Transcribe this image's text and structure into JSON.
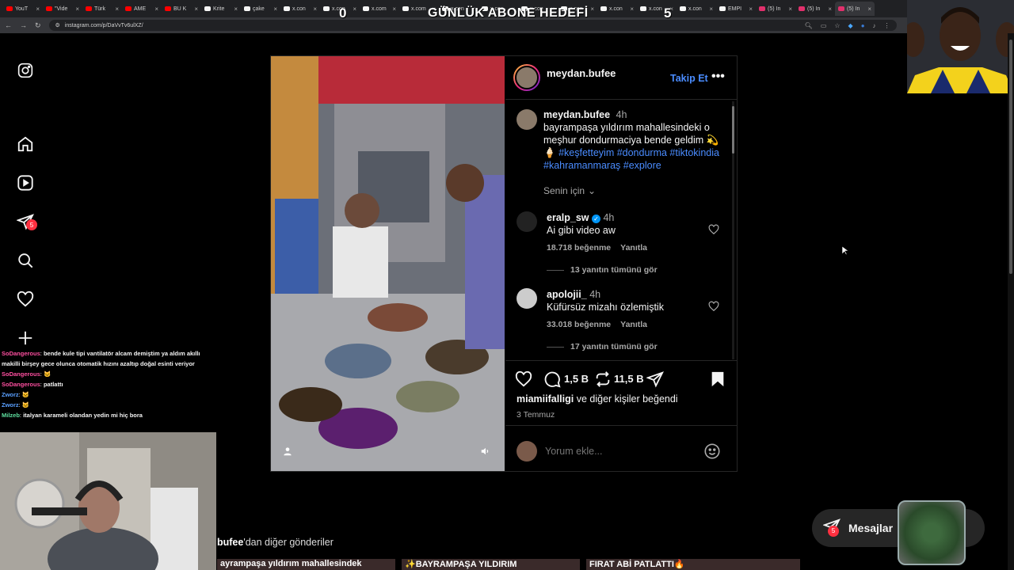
{
  "browser": {
    "tabs": [
      {
        "label": "YouT",
        "color": "#ff0000"
      },
      {
        "label": "\"Vide",
        "color": "#ff0000"
      },
      {
        "label": "Türk",
        "color": "#ff0000"
      },
      {
        "label": "AME",
        "color": "#ff0000"
      },
      {
        "label": "BU K",
        "color": "#ff0000"
      },
      {
        "label": "Krite",
        "color": "#f5f5f5"
      },
      {
        "label": "çake",
        "color": "#f5f5f5"
      },
      {
        "label": "x.con",
        "color": "#f5f5f5"
      },
      {
        "label": "x.con",
        "color": "#f5f5f5"
      },
      {
        "label": "x.com",
        "color": "#f5f5f5"
      },
      {
        "label": "x.com",
        "color": "#f5f5f5"
      },
      {
        "label": "x.con",
        "color": "#f5f5f5"
      },
      {
        "label": "x.con",
        "color": "#f5f5f5"
      },
      {
        "label": "x.con",
        "color": "#f5f5f5"
      },
      {
        "label": "x.con",
        "color": "#f5f5f5"
      },
      {
        "label": "x.con",
        "color": "#f5f5f5"
      },
      {
        "label": "x.con",
        "color": "#f5f5f5"
      },
      {
        "label": "x.con",
        "color": "#f5f5f5"
      },
      {
        "label": "EMPI",
        "color": "#f5f5f5"
      },
      {
        "label": "(5) In",
        "color": "#e1306c"
      },
      {
        "label": "(5) In",
        "color": "#e1306c"
      },
      {
        "label": "(5) In",
        "color": "#e1306c"
      }
    ],
    "url": "instagram.com/p/DaVvTv6ulXZ/"
  },
  "overlay": {
    "goal_current": "0",
    "goal_title": "GÜNLÜK ABONE HEDEFİ",
    "goal_target": "5"
  },
  "sidebar": {
    "notifications_badge": "5"
  },
  "post": {
    "header_username": "meydan.bufee",
    "follow_label": "Takip Et",
    "caption": {
      "username": "meydan.bufee",
      "time": "4h",
      "text": "bayrampaşa yıldırım mahallesindeki o meşhur dondurmaciya bende geldim 💫🍦",
      "hashtags": "#keşfetteyim #dondurma #tiktokindia #kahramanmaraş #explore"
    },
    "sort_label": "Senin için",
    "comments": [
      {
        "username": "eralp_sw",
        "verified": true,
        "time": "4h",
        "text": "Ai gibi video aw",
        "likes": "18.718 beğenme",
        "reply": "Yanıtla",
        "view_replies": "13 yanıtın tümünü gör"
      },
      {
        "username": "apolojii_",
        "verified": false,
        "time": "4h",
        "text": "Küfürsüz mizahı özlemiştik",
        "likes": "33.018 beğenme",
        "reply": "Yanıtla",
        "view_replies": "17 yanıtın tümünü gör"
      }
    ],
    "comment_count": "1,5 B",
    "repost_count": "11,5 B",
    "liked_by_prefix": "miamiifalligi",
    "liked_by_suffix": " ve diğer kişiler beğendi",
    "date": "3 Temmuz",
    "comment_placeholder": "Yorum ekle..."
  },
  "chat": [
    {
      "user": "SoDangerous",
      "sep": ": ",
      "msg": "bende kule tipi vantilatör alcam demiştim ya aldım akıllı makilli birşey gece olunca otomatik hızını azaltıp doğal esinti veriyor",
      "cls": "n1"
    },
    {
      "user": "SoDangerous",
      "sep": ": ",
      "msg": "🐱",
      "cls": "n1"
    },
    {
      "user": "SoDangerous",
      "sep": ": ",
      "msg": "patlattı",
      "cls": "n1"
    },
    {
      "user": "Zworz",
      "sep": ": ",
      "msg": "🐱",
      "cls": "n2"
    },
    {
      "user": "Zworz",
      "sep": ": ",
      "msg": "🐱",
      "cls": "n2"
    },
    {
      "user": "Milzeb",
      "sep": ": ",
      "msg": "italyan karameli olandan yedin mi hiç bora",
      "cls": "n3"
    }
  ],
  "more_posts": {
    "bold": "bufee",
    "rest": "'dan diğer gönderiler"
  },
  "thumbs": [
    "ayrampaşa yıldırım mahallesindek",
    "✨BAYRAMPAŞA YILDIRIM",
    "FIRAT ABİ PATLATTI🔥"
  ],
  "messages": {
    "label": "Mesajlar",
    "badge": "5"
  }
}
